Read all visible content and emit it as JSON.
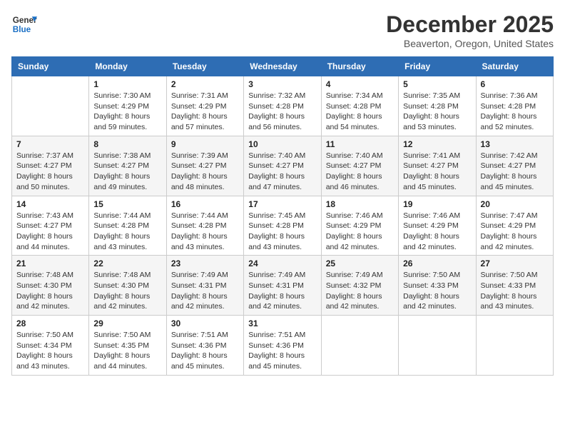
{
  "logo": {
    "line1": "General",
    "line2": "Blue"
  },
  "title": "December 2025",
  "location": "Beaverton, Oregon, United States",
  "weekdays": [
    "Sunday",
    "Monday",
    "Tuesday",
    "Wednesday",
    "Thursday",
    "Friday",
    "Saturday"
  ],
  "weeks": [
    [
      {
        "day": "",
        "info": ""
      },
      {
        "day": "1",
        "info": "Sunrise: 7:30 AM\nSunset: 4:29 PM\nDaylight: 8 hours\nand 59 minutes."
      },
      {
        "day": "2",
        "info": "Sunrise: 7:31 AM\nSunset: 4:29 PM\nDaylight: 8 hours\nand 57 minutes."
      },
      {
        "day": "3",
        "info": "Sunrise: 7:32 AM\nSunset: 4:28 PM\nDaylight: 8 hours\nand 56 minutes."
      },
      {
        "day": "4",
        "info": "Sunrise: 7:34 AM\nSunset: 4:28 PM\nDaylight: 8 hours\nand 54 minutes."
      },
      {
        "day": "5",
        "info": "Sunrise: 7:35 AM\nSunset: 4:28 PM\nDaylight: 8 hours\nand 53 minutes."
      },
      {
        "day": "6",
        "info": "Sunrise: 7:36 AM\nSunset: 4:28 PM\nDaylight: 8 hours\nand 52 minutes."
      }
    ],
    [
      {
        "day": "7",
        "info": "Sunrise: 7:37 AM\nSunset: 4:27 PM\nDaylight: 8 hours\nand 50 minutes."
      },
      {
        "day": "8",
        "info": "Sunrise: 7:38 AM\nSunset: 4:27 PM\nDaylight: 8 hours\nand 49 minutes."
      },
      {
        "day": "9",
        "info": "Sunrise: 7:39 AM\nSunset: 4:27 PM\nDaylight: 8 hours\nand 48 minutes."
      },
      {
        "day": "10",
        "info": "Sunrise: 7:40 AM\nSunset: 4:27 PM\nDaylight: 8 hours\nand 47 minutes."
      },
      {
        "day": "11",
        "info": "Sunrise: 7:40 AM\nSunset: 4:27 PM\nDaylight: 8 hours\nand 46 minutes."
      },
      {
        "day": "12",
        "info": "Sunrise: 7:41 AM\nSunset: 4:27 PM\nDaylight: 8 hours\nand 45 minutes."
      },
      {
        "day": "13",
        "info": "Sunrise: 7:42 AM\nSunset: 4:27 PM\nDaylight: 8 hours\nand 45 minutes."
      }
    ],
    [
      {
        "day": "14",
        "info": "Sunrise: 7:43 AM\nSunset: 4:27 PM\nDaylight: 8 hours\nand 44 minutes."
      },
      {
        "day": "15",
        "info": "Sunrise: 7:44 AM\nSunset: 4:28 PM\nDaylight: 8 hours\nand 43 minutes."
      },
      {
        "day": "16",
        "info": "Sunrise: 7:44 AM\nSunset: 4:28 PM\nDaylight: 8 hours\nand 43 minutes."
      },
      {
        "day": "17",
        "info": "Sunrise: 7:45 AM\nSunset: 4:28 PM\nDaylight: 8 hours\nand 43 minutes."
      },
      {
        "day": "18",
        "info": "Sunrise: 7:46 AM\nSunset: 4:29 PM\nDaylight: 8 hours\nand 42 minutes."
      },
      {
        "day": "19",
        "info": "Sunrise: 7:46 AM\nSunset: 4:29 PM\nDaylight: 8 hours\nand 42 minutes."
      },
      {
        "day": "20",
        "info": "Sunrise: 7:47 AM\nSunset: 4:29 PM\nDaylight: 8 hours\nand 42 minutes."
      }
    ],
    [
      {
        "day": "21",
        "info": "Sunrise: 7:48 AM\nSunset: 4:30 PM\nDaylight: 8 hours\nand 42 minutes."
      },
      {
        "day": "22",
        "info": "Sunrise: 7:48 AM\nSunset: 4:30 PM\nDaylight: 8 hours\nand 42 minutes."
      },
      {
        "day": "23",
        "info": "Sunrise: 7:49 AM\nSunset: 4:31 PM\nDaylight: 8 hours\nand 42 minutes."
      },
      {
        "day": "24",
        "info": "Sunrise: 7:49 AM\nSunset: 4:31 PM\nDaylight: 8 hours\nand 42 minutes."
      },
      {
        "day": "25",
        "info": "Sunrise: 7:49 AM\nSunset: 4:32 PM\nDaylight: 8 hours\nand 42 minutes."
      },
      {
        "day": "26",
        "info": "Sunrise: 7:50 AM\nSunset: 4:33 PM\nDaylight: 8 hours\nand 42 minutes."
      },
      {
        "day": "27",
        "info": "Sunrise: 7:50 AM\nSunset: 4:33 PM\nDaylight: 8 hours\nand 43 minutes."
      }
    ],
    [
      {
        "day": "28",
        "info": "Sunrise: 7:50 AM\nSunset: 4:34 PM\nDaylight: 8 hours\nand 43 minutes."
      },
      {
        "day": "29",
        "info": "Sunrise: 7:50 AM\nSunset: 4:35 PM\nDaylight: 8 hours\nand 44 minutes."
      },
      {
        "day": "30",
        "info": "Sunrise: 7:51 AM\nSunset: 4:36 PM\nDaylight: 8 hours\nand 45 minutes."
      },
      {
        "day": "31",
        "info": "Sunrise: 7:51 AM\nSunset: 4:36 PM\nDaylight: 8 hours\nand 45 minutes."
      },
      {
        "day": "",
        "info": ""
      },
      {
        "day": "",
        "info": ""
      },
      {
        "day": "",
        "info": ""
      }
    ]
  ]
}
